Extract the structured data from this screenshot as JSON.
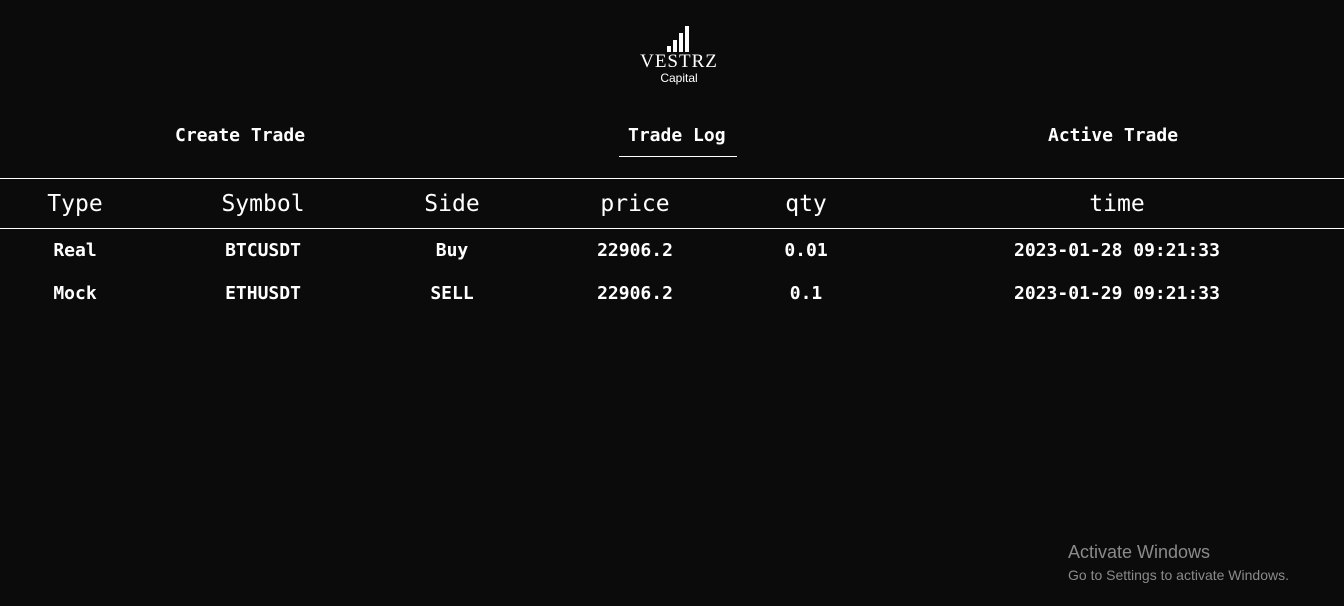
{
  "logo": {
    "icon": "signal-bars-icon",
    "name": "VESTRZ",
    "subtitle": "Capital"
  },
  "nav": {
    "items": [
      {
        "label": "Create Trade"
      },
      {
        "label": "Trade Log",
        "active": true
      },
      {
        "label": "Active Trade"
      }
    ]
  },
  "table": {
    "headers": [
      "Type",
      "Symbol",
      "Side",
      "price",
      "qty",
      "time"
    ],
    "rows": [
      [
        "Real",
        "BTCUSDT",
        "Buy",
        "22906.2",
        "0.01",
        "2023-01-28 09:21:33"
      ],
      [
        "Mock",
        "ETHUSDT",
        "SELL",
        "22906.2",
        "0.1",
        "2023-01-29 09:21:33"
      ]
    ]
  },
  "watermark": {
    "title": "Activate Windows",
    "subtitle": "Go to Settings to activate Windows."
  },
  "colors": {
    "background": "#0b0b0b",
    "text": "#ffffff",
    "watermark": "#8a8a8a"
  }
}
